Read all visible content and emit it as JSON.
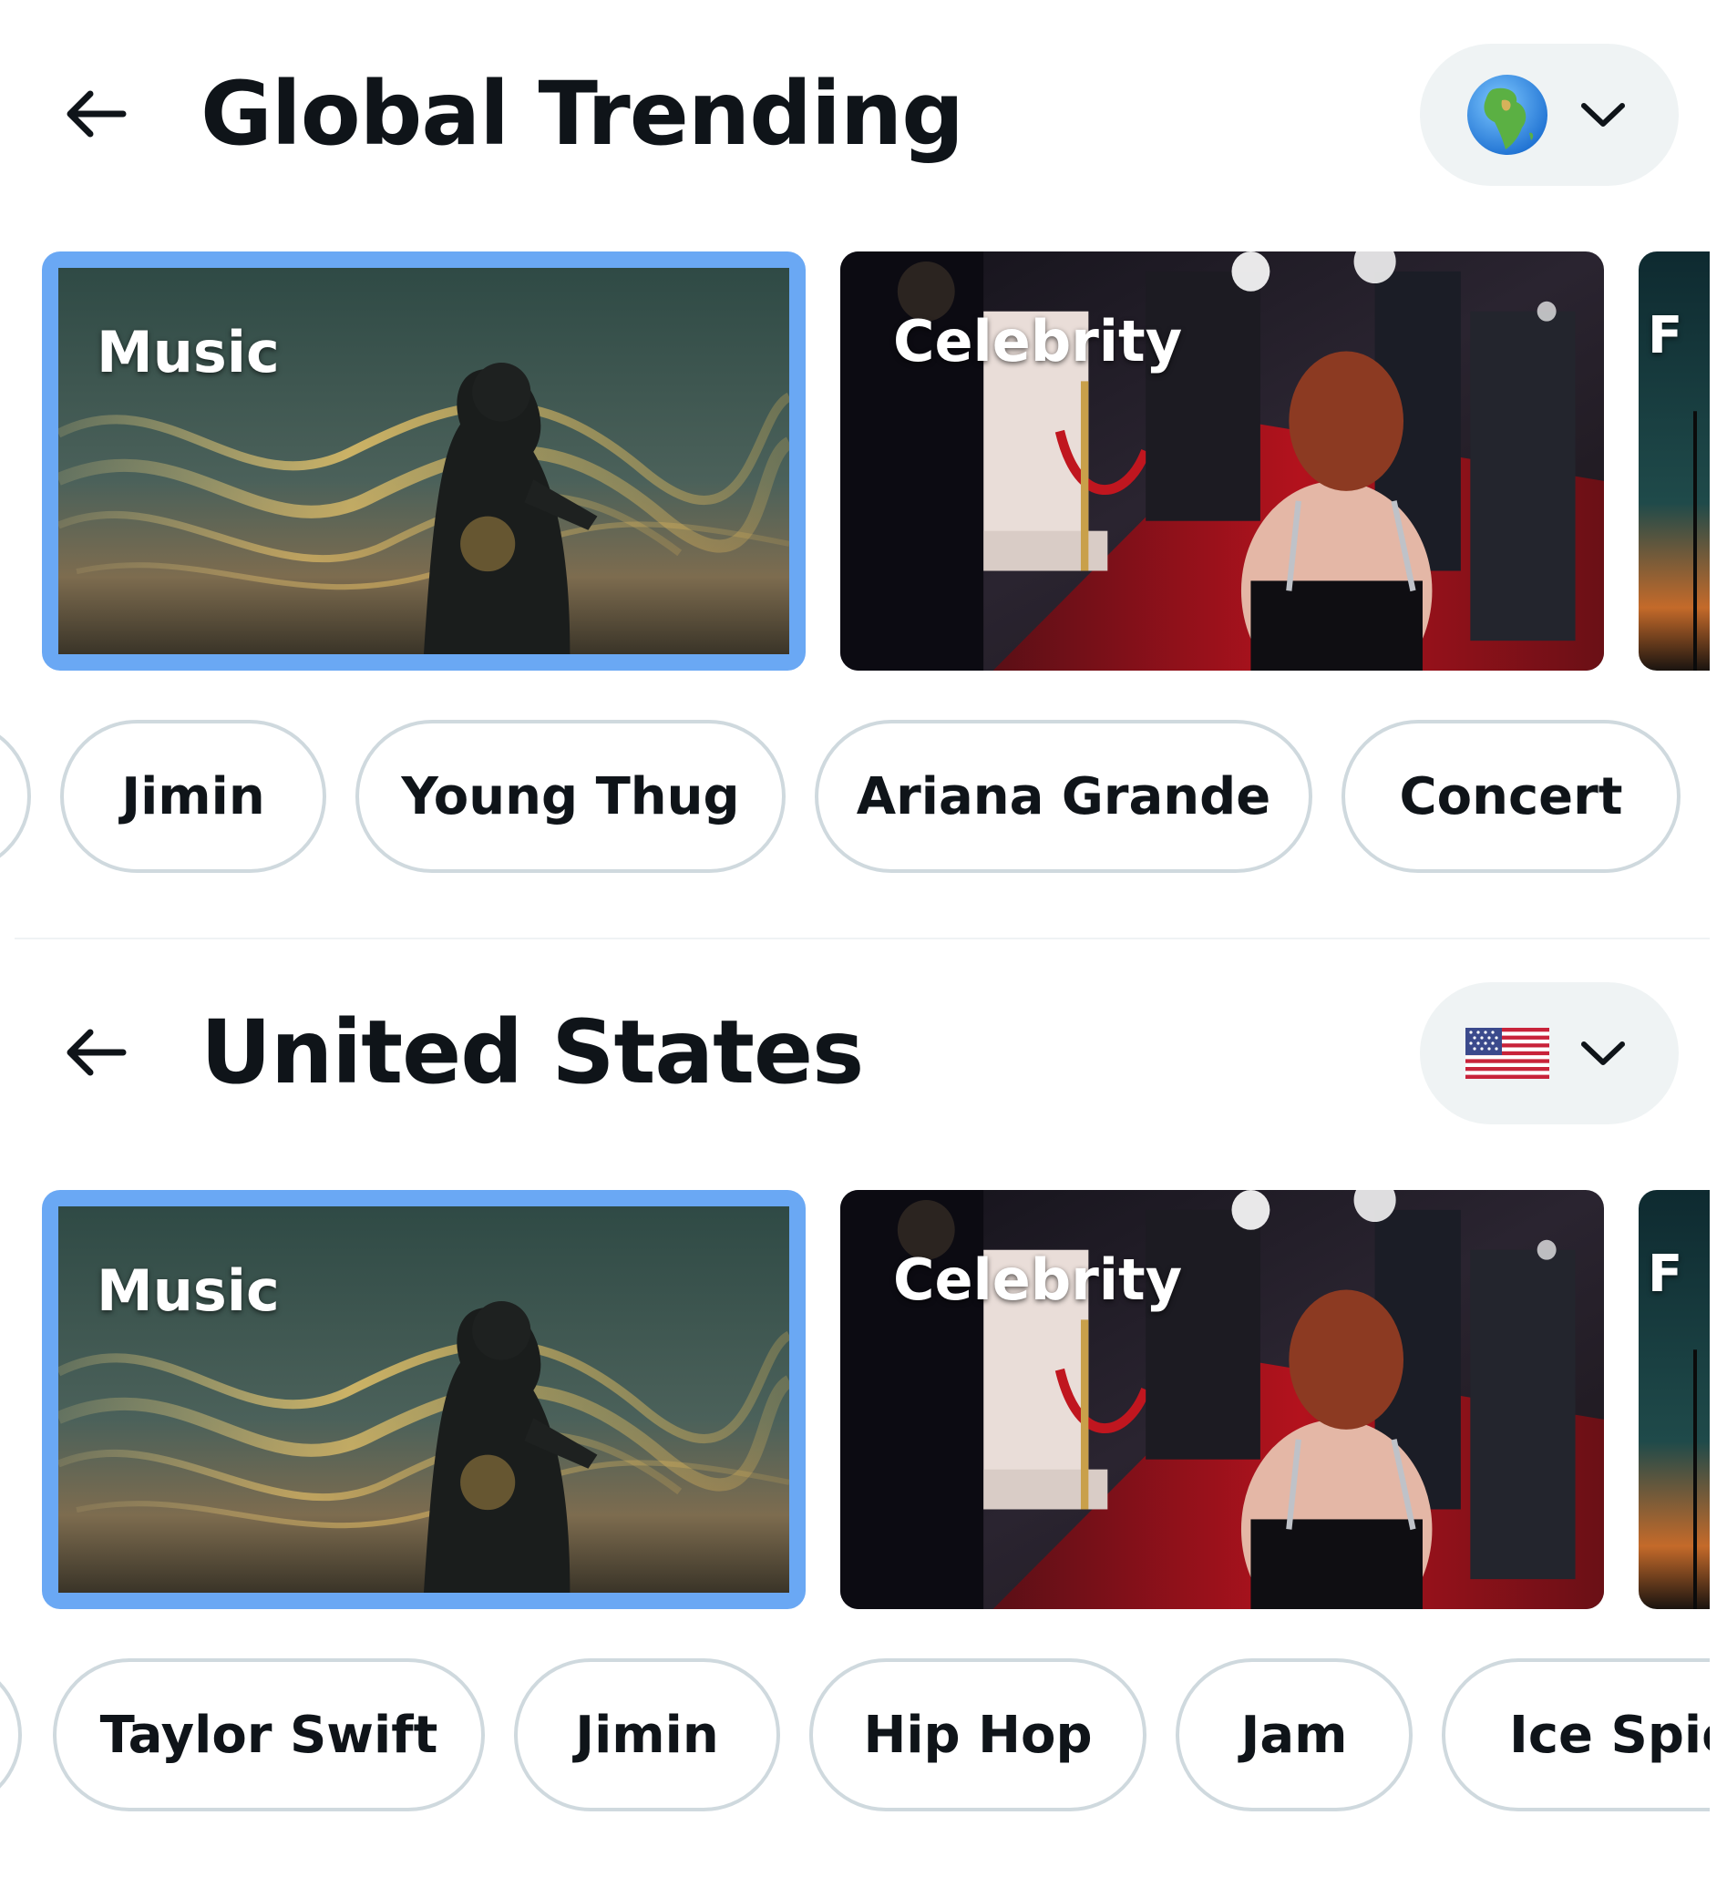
{
  "sections": [
    {
      "title": "Global Trending",
      "region_icon": "globe-africa-icon",
      "cards": [
        {
          "label": "Music",
          "selected": true
        },
        {
          "label": "Celebrity",
          "selected": false
        },
        {
          "label": "F",
          "selected": false
        }
      ],
      "chips": [
        "Jimin",
        "Young Thug",
        "Ariana Grande",
        "Concert"
      ]
    },
    {
      "title": "United States",
      "region_icon": "us-flag-icon",
      "cards": [
        {
          "label": "Music",
          "selected": true
        },
        {
          "label": "Celebrity",
          "selected": false
        },
        {
          "label": "F",
          "selected": false
        }
      ],
      "chips": [
        "Taylor Swift",
        "Jimin",
        "Hip Hop",
        "Jam",
        "Ice Spic"
      ]
    }
  ],
  "colors": {
    "selected_border": "#6aa8f4",
    "chip_border": "#cfd9de",
    "region_button_bg": "#eff3f4",
    "text": "#0f1419"
  }
}
